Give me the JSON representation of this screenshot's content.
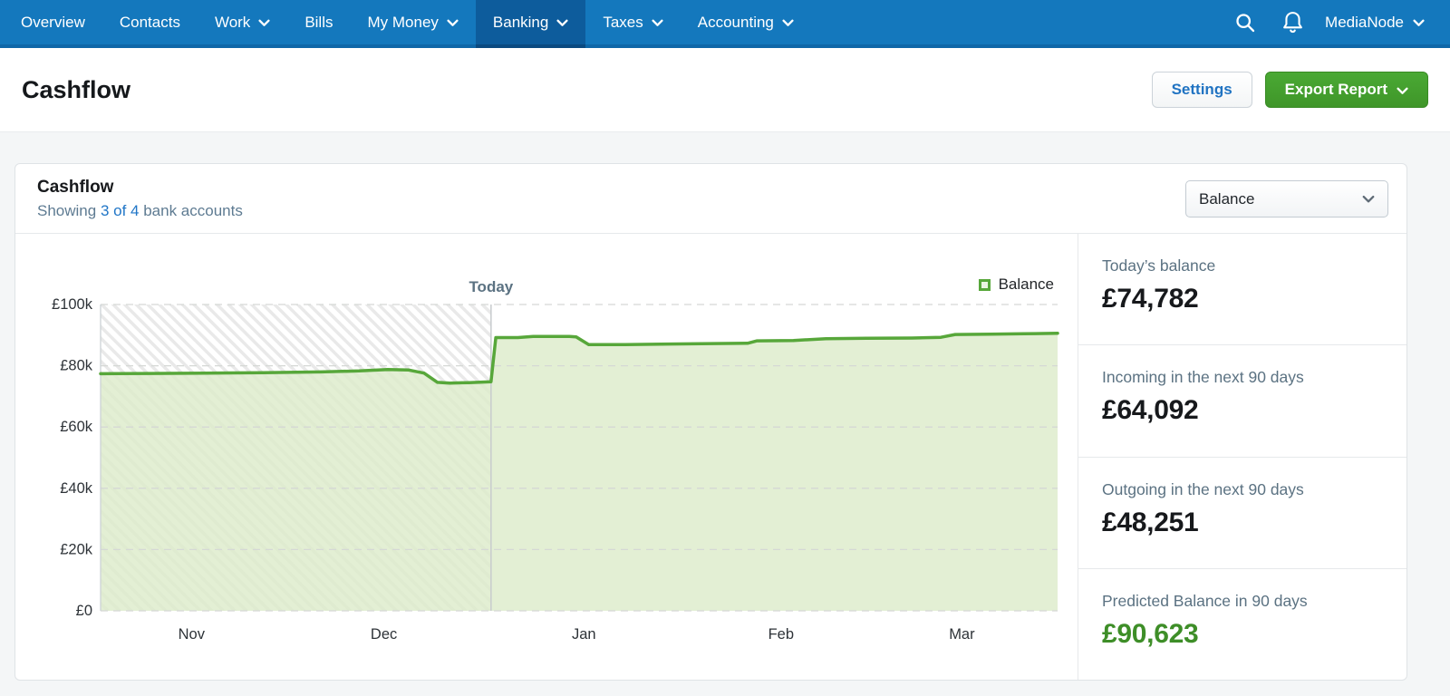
{
  "nav": {
    "items": [
      {
        "label": "Overview",
        "chevron": false,
        "active": false
      },
      {
        "label": "Contacts",
        "chevron": false,
        "active": false
      },
      {
        "label": "Work",
        "chevron": true,
        "active": false
      },
      {
        "label": "Bills",
        "chevron": false,
        "active": false
      },
      {
        "label": "My Money",
        "chevron": true,
        "active": false
      },
      {
        "label": "Banking",
        "chevron": true,
        "active": true
      },
      {
        "label": "Taxes",
        "chevron": true,
        "active": false
      },
      {
        "label": "Accounting",
        "chevron": true,
        "active": false
      }
    ],
    "account_label": "MediaNode"
  },
  "header": {
    "title": "Cashflow",
    "settings_label": "Settings",
    "export_label": "Export Report"
  },
  "panel": {
    "title": "Cashflow",
    "subtitle_prefix": "Showing ",
    "subtitle_link": "3 of 4",
    "subtitle_suffix": " bank accounts",
    "metric_select_value": "Balance"
  },
  "stats": [
    {
      "label": "Today’s balance",
      "value": "£74,782",
      "color": "#17191c"
    },
    {
      "label": "Incoming in the next 90 days",
      "value": "£64,092",
      "color": "#17191c"
    },
    {
      "label": "Outgoing in the next 90 days",
      "value": "£48,251",
      "color": "#17191c"
    },
    {
      "label": "Predicted Balance in 90 days",
      "value": "£90,623",
      "color": "#3e8e28"
    }
  ],
  "chart_data": {
    "type": "area",
    "title": "Cashflow balance over time",
    "today_label": "Today",
    "today_pos": 0.408,
    "grid": "dashed-horizontal",
    "legend_position": "top-right",
    "y_axis": {
      "max": 100000,
      "min": 0,
      "ticks": [
        {
          "label": "£100k",
          "value": 100000
        },
        {
          "label": "£80k",
          "value": 80000
        },
        {
          "label": "£60k",
          "value": 60000
        },
        {
          "label": "£40k",
          "value": 40000
        },
        {
          "label": "£20k",
          "value": 20000
        },
        {
          "label": "£0",
          "value": 0
        }
      ]
    },
    "x_axis": {
      "ticks": [
        {
          "label": "Nov",
          "pos": 0.095
        },
        {
          "label": "Dec",
          "pos": 0.296
        },
        {
          "label": "Jan",
          "pos": 0.505
        },
        {
          "label": "Feb",
          "pos": 0.711
        },
        {
          "label": "Mar",
          "pos": 0.9
        }
      ]
    },
    "series": [
      {
        "name": "Balance",
        "color": "#57a73a",
        "fill": "#dcebc9",
        "points": [
          [
            0.0,
            77400
          ],
          [
            0.05,
            77500
          ],
          [
            0.11,
            77600
          ],
          [
            0.17,
            77750
          ],
          [
            0.23,
            78000
          ],
          [
            0.27,
            78300
          ],
          [
            0.3,
            78800
          ],
          [
            0.322,
            78600
          ],
          [
            0.338,
            77600
          ],
          [
            0.352,
            74600
          ],
          [
            0.365,
            74350
          ],
          [
            0.385,
            74500
          ],
          [
            0.408,
            74782
          ],
          [
            0.413,
            89200
          ],
          [
            0.436,
            89200
          ],
          [
            0.452,
            89600
          ],
          [
            0.49,
            89600
          ],
          [
            0.497,
            89400
          ],
          [
            0.51,
            86900
          ],
          [
            0.548,
            86900
          ],
          [
            0.595,
            87100
          ],
          [
            0.64,
            87250
          ],
          [
            0.676,
            87350
          ],
          [
            0.686,
            88150
          ],
          [
            0.724,
            88250
          ],
          [
            0.758,
            88850
          ],
          [
            0.8,
            88950
          ],
          [
            0.848,
            89050
          ],
          [
            0.878,
            89300
          ],
          [
            0.893,
            90200
          ],
          [
            0.93,
            90300
          ],
          [
            0.965,
            90450
          ],
          [
            1.0,
            90623
          ]
        ]
      }
    ]
  },
  "colors": {
    "nav_bg": "#1478bd",
    "nav_active_bg": "#0d5c9c",
    "accent_blue": "#2073c2",
    "accent_green": "#43a02e",
    "stat_green": "#3e8e28",
    "chart_line": "#57a73a",
    "chart_fill": "#dcebc9",
    "hatch_stripe": "#e9e9e9"
  }
}
